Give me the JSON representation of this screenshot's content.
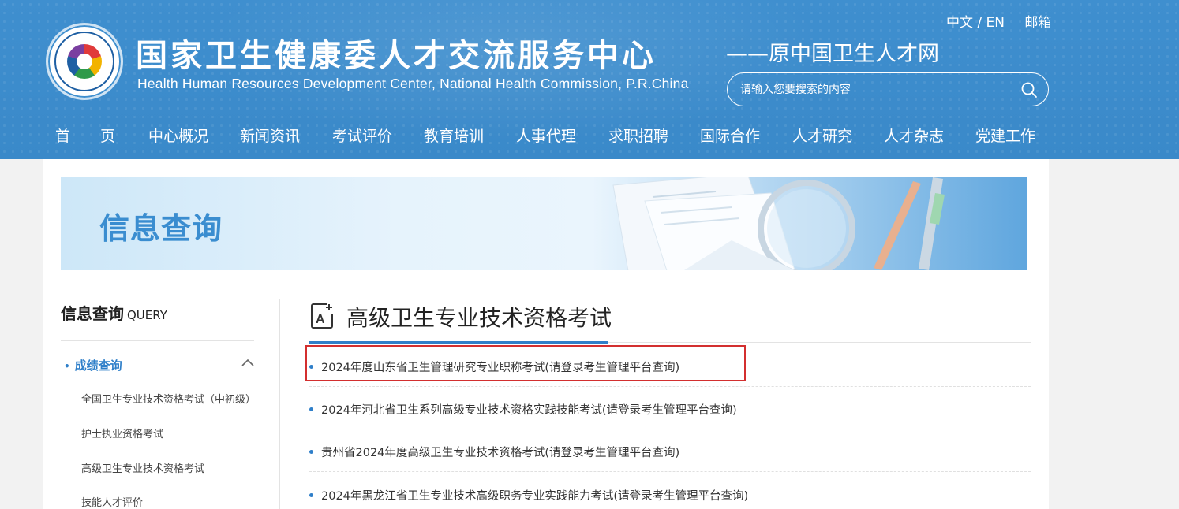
{
  "header": {
    "title_cn": "国家卫生健康委人才交流服务中心",
    "title_en": "Health Human Resources Development Center, National Health Commission, P.R.China",
    "subtitle": "——原中国卫生人才网",
    "lang_switch": "中文 / EN",
    "mail": "邮箱",
    "search": {
      "placeholder": "请输入您要搜索的内容",
      "icon": "search-icon"
    },
    "nav": [
      "首　　页",
      "中心概况",
      "新闻资讯",
      "考试评价",
      "教育培训",
      "人事代理",
      "求职招聘",
      "国际合作",
      "人才研究",
      "人才杂志",
      "党建工作"
    ],
    "colors": {
      "header_bg": "#3a89c9",
      "accent": "#2f7fc9",
      "highlight": "#d32f2f"
    }
  },
  "banner": {
    "title": "信息查询"
  },
  "sidebar": {
    "title": "信息查询",
    "title_en": "QUERY",
    "active": {
      "dot": "•",
      "label": "成绩查询",
      "icon": "chevron-up-icon"
    },
    "items": [
      "全国卫生专业技术资格考试（中初级）",
      "护士执业资格考试",
      "高级卫生专业技术资格考试",
      "技能人才评价"
    ]
  },
  "main": {
    "section_title": "高级卫生专业技术资格考试",
    "section_icon": "edit-document-icon",
    "list": [
      "2024年度山东省卫生管理研究专业职称考试(请登录考生管理平台查询)",
      "2024年河北省卫生系列高级专业技术资格实践技能考试(请登录考生管理平台查询)",
      "贵州省2024年度高级卫生专业技术资格考试(请登录考生管理平台查询)",
      "2024年黑龙江省卫生专业技术高级职务专业实践能力考试(请登录考生管理平台查询)"
    ]
  }
}
